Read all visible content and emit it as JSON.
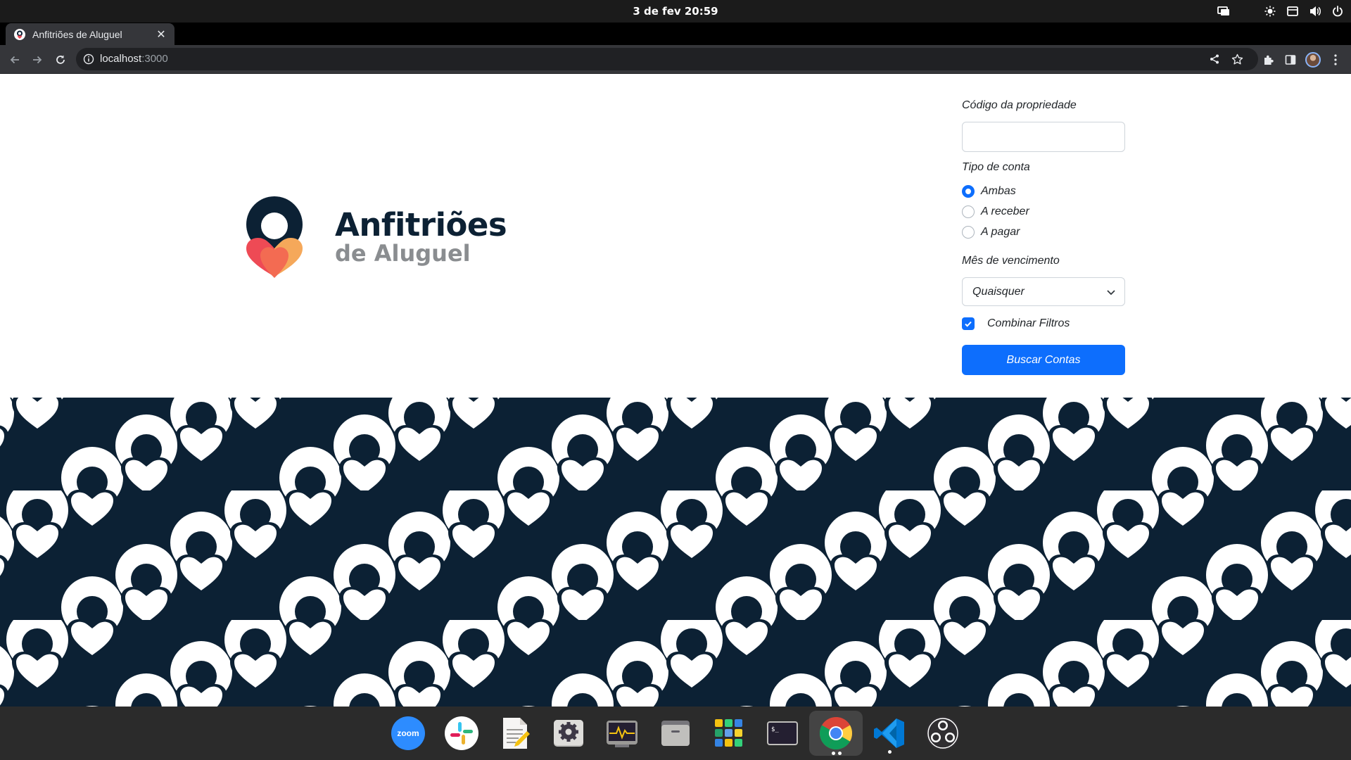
{
  "system_bar": {
    "datetime": "3 de fev  20:59",
    "tray_icons": [
      "screen-share-icon",
      "brightness-icon",
      "app-indicator-icon",
      "volume-icon",
      "power-icon"
    ]
  },
  "browser": {
    "tab_title": "Anfitriões de Aluguel",
    "url_host": "localhost",
    "url_port": ":3000",
    "accent_color": "#8ab4f8"
  },
  "brand": {
    "line1": "Anfitriões",
    "line2": "de Aluguel",
    "primary_color": "#0c2134",
    "heart_colors": [
      "#ee4a55",
      "#f5a85a",
      "#f36b52"
    ]
  },
  "form": {
    "property_code_label": "Código da propriedade",
    "property_code_value": "",
    "account_type_label": "Tipo de conta",
    "account_type_options": [
      {
        "label": "Ambas",
        "checked": true
      },
      {
        "label": "A receber",
        "checked": false
      },
      {
        "label": "A pagar",
        "checked": false
      }
    ],
    "due_month_label": "Mês de vencimento",
    "due_month_value": "Quaisquer",
    "combine_filters_label": "Combinar Filtros",
    "combine_filters_checked": true,
    "submit_label": "Buscar Contas",
    "button_color": "#0d6efd"
  },
  "pattern": {
    "background_color": "#0c2134",
    "motif_color": "#ffffff"
  },
  "dock": {
    "apps": [
      {
        "name": "zoom",
        "label": "zoom",
        "running": false
      },
      {
        "name": "slack",
        "running": false
      },
      {
        "name": "text-editor",
        "running": false
      },
      {
        "name": "settings",
        "running": false
      },
      {
        "name": "system-monitor",
        "running": false
      },
      {
        "name": "files",
        "running": false
      },
      {
        "name": "app-grid",
        "running": false
      },
      {
        "name": "terminal",
        "label": "$_",
        "running": false
      },
      {
        "name": "chrome",
        "running": true,
        "windows": 2
      },
      {
        "name": "vscode",
        "running": true,
        "windows": 1
      },
      {
        "name": "obs",
        "running": false
      }
    ]
  }
}
